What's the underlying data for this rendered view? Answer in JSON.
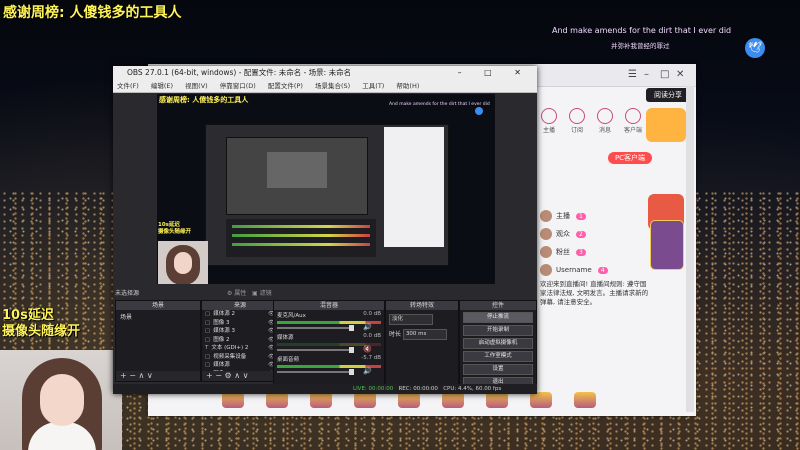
{
  "overlay": {
    "thanks_title": "感谢周榜: 人傻钱多的工具人",
    "delay_line1": "10s延迟",
    "delay_line2": "摄像头随缘开",
    "lyric_en": "And make amends for the dirt that I ever did",
    "lyric_cn": "并弥补我曾经的罪过",
    "lyric_logo_icon": "bird-logo-icon"
  },
  "obs": {
    "title": "OBS 27.0.1 (64-bit, windows) - 配置文件: 未命名 - 场景: 未命名",
    "window_controls": "–  □  ✕",
    "menu": [
      "文件(F)",
      "编辑(E)",
      "视图(V)",
      "停靠窗口(D)",
      "配置文件(P)",
      "场景集合(S)",
      "工具(T)",
      "帮助(H)"
    ],
    "preview": {
      "title": "感谢周榜: 人傻钱多的工具人",
      "lyric": "And make amends for the dirt that I ever did",
      "delay_line1": "10s延迟",
      "delay_line2": "摄像头随缘开"
    },
    "dock_tabs": {
      "no_source": "未选择源",
      "properties": "⚙ 属性",
      "filters": "▣ 滤镜"
    },
    "scenes": {
      "header": "场景",
      "items": [
        "场景"
      ],
      "footer": "+  −  ∧  ∨"
    },
    "sources": {
      "header": "来源",
      "items": [
        {
          "icon": "▢",
          "label": "媒体源 2"
        },
        {
          "icon": "▢",
          "label": "图像 3"
        },
        {
          "icon": "▢",
          "label": "媒体源 3"
        },
        {
          "icon": "▢",
          "label": "图像 2"
        },
        {
          "icon": "T",
          "label": "文本 (GDI+) 2"
        },
        {
          "icon": "▢",
          "label": "视频采集设备"
        },
        {
          "icon": "▢",
          "label": "媒体源"
        },
        {
          "icon": "▢",
          "label": "图像"
        }
      ],
      "footer": "+  −  ⚙  ∧  ∨"
    },
    "mixer": {
      "header": "混音器",
      "channels": [
        {
          "name": "麦克风/Aux",
          "level": "0.0 dB",
          "muted": false
        },
        {
          "name": "媒体源",
          "level": "0.0 dB",
          "muted": true
        },
        {
          "name": "桌面音频",
          "level": "-5.7 dB",
          "muted": false
        }
      ]
    },
    "transitions": {
      "header": "转场特效",
      "type": "淡化",
      "duration_label": "时长",
      "duration": "300 ms"
    },
    "controls": {
      "header": "控件",
      "buttons": [
        "停止推流",
        "开始录制",
        "启动虚拟摄像机",
        "工作室模式",
        "设置",
        "退出"
      ]
    },
    "status": {
      "live": "LIVE: 00:00:00",
      "rec": "REC: 00:00:00",
      "cpu": "CPU: 4.4%, 60.00 fps"
    }
  },
  "browser": {
    "share_button": "阅读分享",
    "right_panel_icons": [
      "主播",
      "订阅",
      "消息",
      "客户端"
    ],
    "pc_button": "PC客户端",
    "rank_rows": [
      {
        "name": "主播",
        "badge": "1"
      },
      {
        "name": "观众",
        "badge": "2"
      },
      {
        "name": "粉丝",
        "badge": "3"
      },
      {
        "name": "Username",
        "badge": "4"
      }
    ],
    "chat_text": "欢迎来到直播间! 直播间规则: 遵守国家法律法规, 文明发言。主播请求新的弹幕, 请注意安全。"
  }
}
